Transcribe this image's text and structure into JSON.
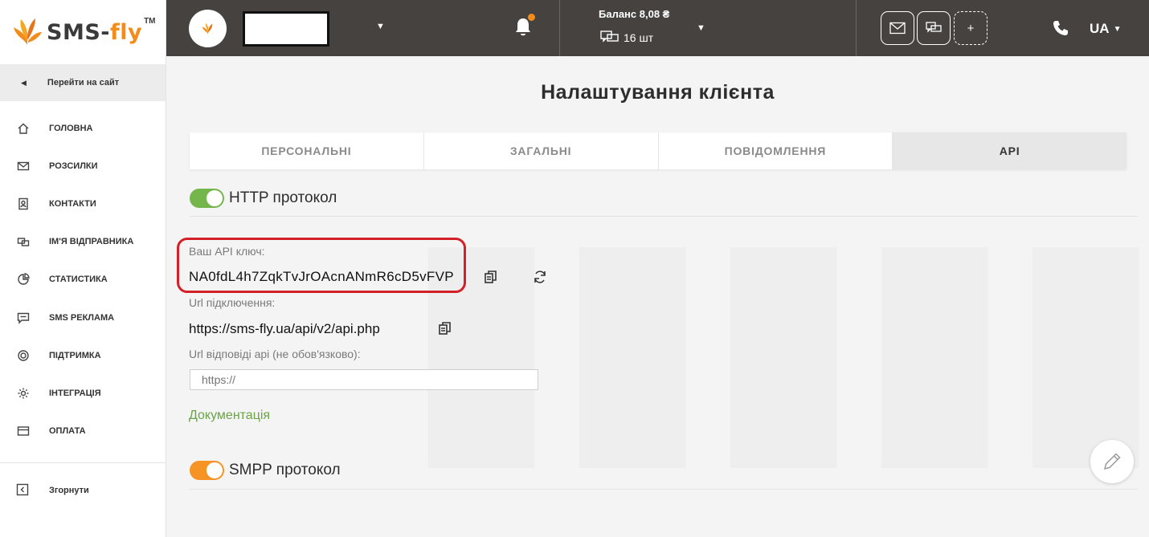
{
  "sidebar": {
    "logo": {
      "text_main": "SMS-",
      "text_accent": "fly",
      "trademark": "TM"
    },
    "goto_site": "Перейти на сайт",
    "items": [
      {
        "label": "ГОЛОВНА",
        "icon": "home-icon"
      },
      {
        "label": "РОЗСИЛКИ",
        "icon": "envelope-icon"
      },
      {
        "label": "КОНТАКТИ",
        "icon": "contact-book-icon"
      },
      {
        "label": "ІМ'Я ВІДПРАВНИКА",
        "icon": "sender-name-icon"
      },
      {
        "label": "СТАТИСТИКА",
        "icon": "pie-chart-icon"
      },
      {
        "label": "SMS РЕКЛАМА",
        "icon": "sms-ad-icon"
      },
      {
        "label": "ПІДТРИМКА",
        "icon": "support-icon"
      },
      {
        "label": "ІНТЕГРАЦІЯ",
        "icon": "gear-icon"
      },
      {
        "label": "ОПЛАТА",
        "icon": "credit-card-icon"
      }
    ],
    "collapse": "Згорнути"
  },
  "topbar": {
    "balance": "Баланс 8,08 ₴",
    "sms_count": "16 шт",
    "language": "UA",
    "plus": "+"
  },
  "page": {
    "title": "Налаштування клієнта",
    "tabs": [
      {
        "label": "ПЕРСОНАЛЬНІ",
        "active": false
      },
      {
        "label": "ЗАГАЛЬНІ",
        "active": false
      },
      {
        "label": "ПОВІДОМЛЕННЯ",
        "active": false
      },
      {
        "label": "API",
        "active": true
      }
    ],
    "http": {
      "label": "HTTP протокол",
      "enabled": true,
      "api_key_label": "Ваш API ключ:",
      "api_key": "NA0fdL4h7ZqkTvJrOAcnANmR6cD5vFVP",
      "url_label": "Url підключення:",
      "url": "https://sms-fly.ua/api/v2/api.php",
      "reply_url_label": "Url відповіді api (не обов'язково):",
      "reply_url_placeholder": "https://",
      "docs_link": "Документація"
    },
    "smpp": {
      "label": "SMPP протокол",
      "enabled": true
    }
  },
  "colors": {
    "topbar_bg": "#464240",
    "accent_orange": "#f28c1b",
    "toggle_green": "#74b54c",
    "toggle_orange": "#f59324",
    "highlight_red": "#d31f27",
    "link_green": "#6aa446"
  }
}
